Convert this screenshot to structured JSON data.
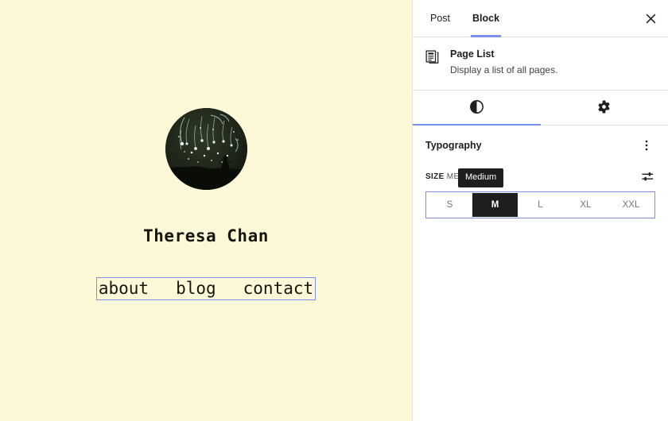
{
  "theme": {
    "canvas_background": "#FDF9D8",
    "panel_background": "#FFFFFF",
    "accent": "#7B8FF0",
    "selected_segment_background": "#1E1E1E",
    "text": "#1E1E1E"
  },
  "canvas": {
    "avatar": {
      "icon": "night-sky-avatar-image",
      "alt": "Circular photo of a dark night sky with shooting stars over a silhouetted landscape"
    },
    "site_title": "Theresa Chan",
    "nav": {
      "items": [
        {
          "label": "about"
        },
        {
          "label": "blog"
        },
        {
          "label": "contact"
        }
      ]
    }
  },
  "sidebar": {
    "header": {
      "tabs": [
        {
          "label": "Post",
          "active": false
        },
        {
          "label": "Block",
          "active": true
        }
      ],
      "close_icon": "close-icon"
    },
    "block_card": {
      "icon": "page-list-icon",
      "title": "Page List",
      "description": "Display a list of all pages."
    },
    "icon_tabs": [
      {
        "icon": "contrast-icon",
        "name": "styles-tab",
        "active": true
      },
      {
        "icon": "gear-icon",
        "name": "settings-tab",
        "active": false
      }
    ],
    "typography": {
      "title": "Typography",
      "options_icon": "kebab-menu-icon",
      "size": {
        "label": "SIZE",
        "value": "ME",
        "settings_icon": "sliders-icon",
        "tooltip": "Medium",
        "segments": [
          {
            "label": "S",
            "selected": false
          },
          {
            "label": "M",
            "selected": true
          },
          {
            "label": "L",
            "selected": false
          },
          {
            "label": "XL",
            "selected": false
          },
          {
            "label": "XXL",
            "selected": false
          }
        ]
      }
    }
  }
}
